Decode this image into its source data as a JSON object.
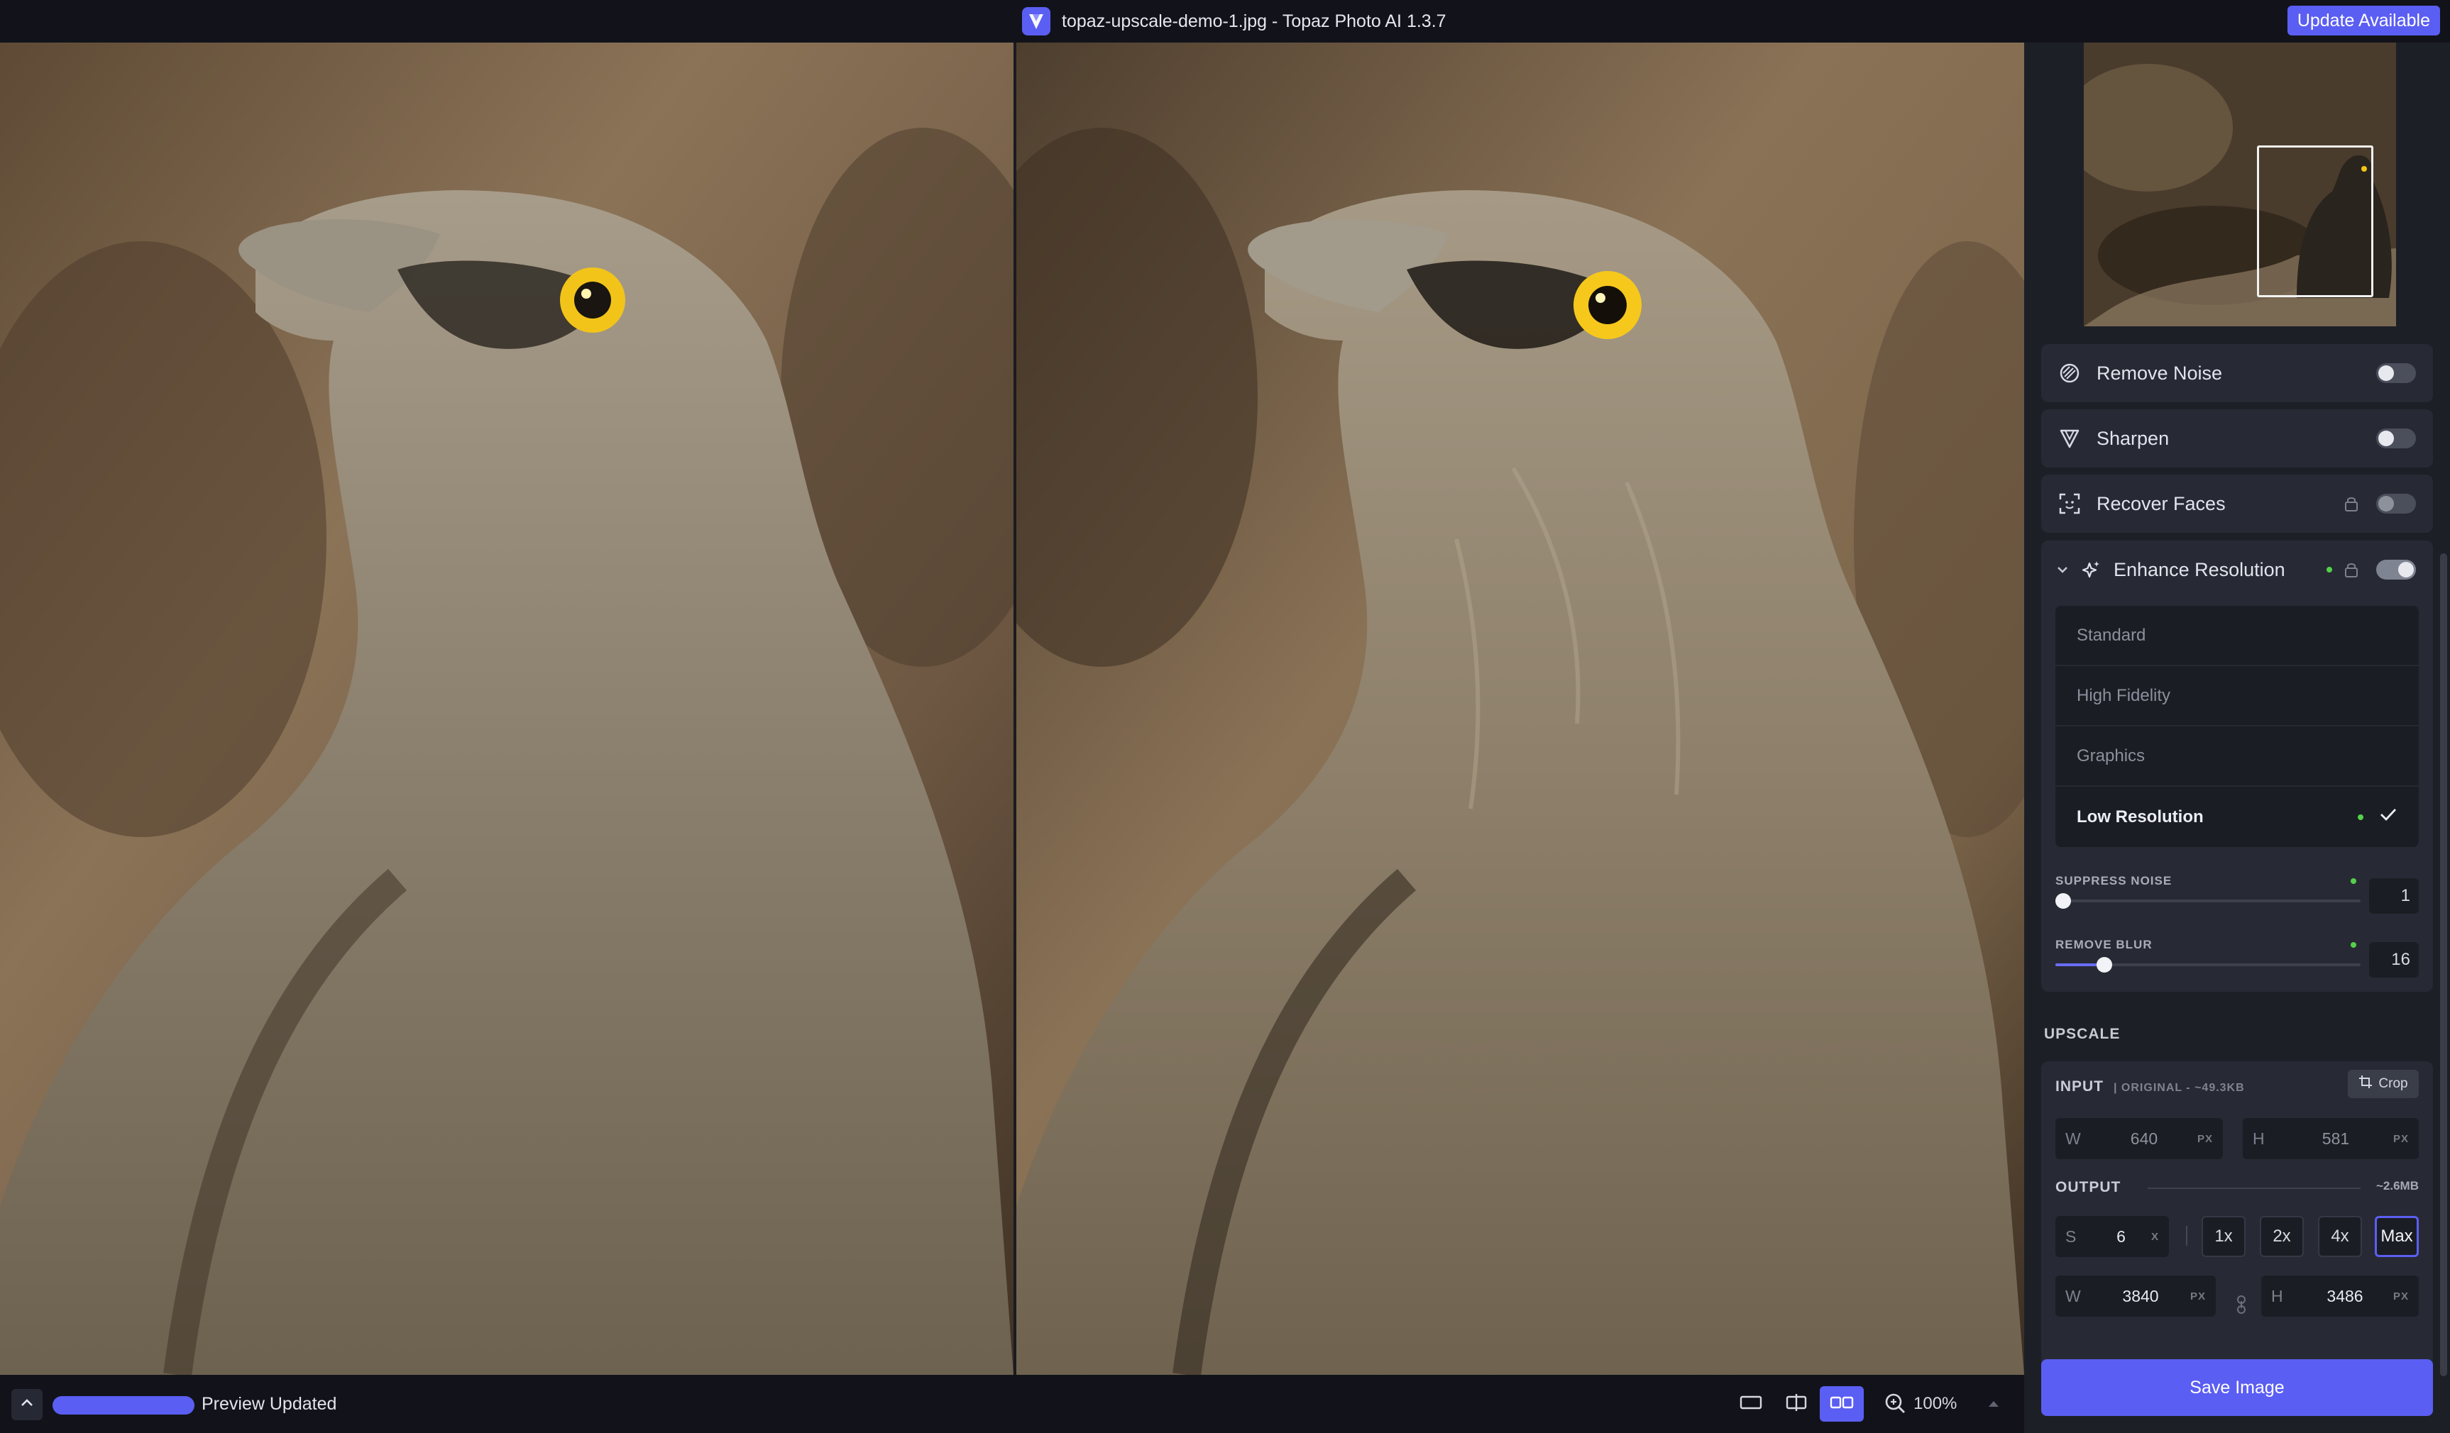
{
  "window": {
    "title": "topaz-upscale-demo-1.jpg - Topaz Photo AI 1.3.7",
    "update_label": "Update Available"
  },
  "panel": {
    "filters": [
      {
        "label": "Remove Noise",
        "icon": "remove-noise-icon",
        "enabled": false
      },
      {
        "label": "Sharpen",
        "icon": "sharpen-icon",
        "enabled": false
      },
      {
        "label": "Recover Faces",
        "icon": "recover-faces-icon",
        "enabled": false,
        "locked": true
      }
    ],
    "enhance": {
      "label": "Enhance Resolution",
      "enabled": true,
      "models": [
        "Standard",
        "High Fidelity",
        "Graphics",
        "Low Resolution"
      ],
      "selected_model": "Low Resolution",
      "suppress_noise": {
        "label": "SUPPRESS NOISE",
        "value": "1",
        "fraction": 0.01
      },
      "remove_blur": {
        "label": "REMOVE BLUR",
        "value": "16",
        "fraction": 0.16
      }
    },
    "upscale": {
      "section_title": "UPSCALE",
      "input_label": "INPUT",
      "input_info": "| ORIGINAL - ~49.3KB",
      "crop_label": "Crop",
      "input_w_prefix": "W",
      "input_w": "640",
      "input_h_prefix": "H",
      "input_h": "581",
      "unit_px": "PX",
      "output_label": "OUTPUT",
      "output_size": "~2.6MB",
      "scale_prefix": "S",
      "scale_value": "6",
      "scale_unit": "X",
      "scale_options": [
        "1x",
        "2x",
        "4x",
        "Max"
      ],
      "selected_scale": "Max",
      "output_w": "3840",
      "output_h": "3486"
    },
    "save_label": "Save Image"
  },
  "bottom": {
    "status": "Preview Updated",
    "zoom": "100%",
    "selected_view": "side-by-side"
  },
  "colors": {
    "accent": "#5b5ef2",
    "status_dot": "#54d14a"
  }
}
